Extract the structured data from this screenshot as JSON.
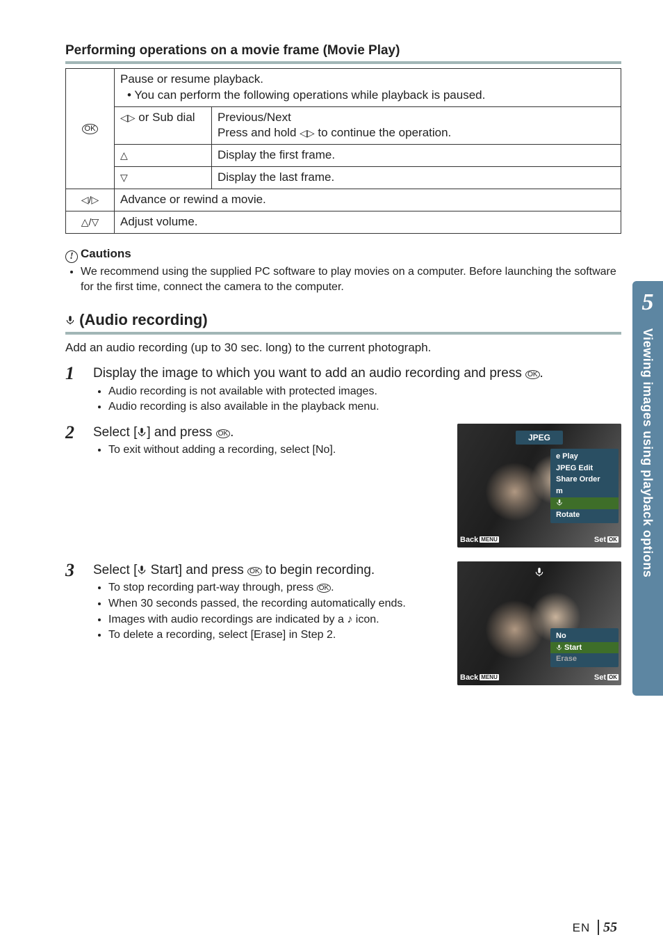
{
  "section1": {
    "title": "Performing operations on a movie frame (Movie Play)"
  },
  "table": {
    "ok_top1": "Pause or resume playback.",
    "ok_top2": "You can perform the following operations while playback is paused.",
    "subdial_label": "or Sub dial",
    "subdial_desc_l1": "Previous/Next",
    "subdial_desc_l2_a": "Press and hold ",
    "subdial_desc_l2_b": " to continue the operation.",
    "up_desc": "Display the first frame.",
    "down_desc": "Display the last frame.",
    "lr_desc": "Advance or rewind a movie.",
    "ud_desc": "Adjust volume."
  },
  "cautions": {
    "heading": "Cautions",
    "item1": "We recommend using the supplied PC software to play movies on a computer. Before launching the software for the first time, connect the camera to the computer."
  },
  "audio": {
    "heading": " (Audio recording)",
    "intro": "Add an audio recording (up to 30 sec. long) to the current photograph."
  },
  "steps": [
    {
      "num": "1",
      "body_a": "Display the image to which you want to add an audio recording and press ",
      "body_b": ".",
      "subs": [
        "Audio recording is not available with protected images.",
        "Audio recording is also available in the playback menu."
      ]
    },
    {
      "num": "2",
      "body_a": "Select [",
      "body_b": "] and press ",
      "body_c": ".",
      "subs": [
        "To exit without adding a recording, select [No]."
      ]
    },
    {
      "num": "3",
      "body_a": "Select [",
      "body_b": " Start] and press ",
      "body_c": " to begin recording.",
      "subs": [
        "To stop recording part-way through, press Q.",
        "When 30 seconds passed, the recording automatically ends.",
        "Images with audio recordings are indicated by a H icon.",
        "To delete a recording, select [Erase] in Step 2."
      ]
    }
  ],
  "screen1": {
    "title": "JPEG",
    "menu": [
      "e Play",
      "JPEG Edit",
      "Share Order",
      "m",
      "R",
      "Rotate"
    ],
    "hl_index": 4,
    "back": "Back",
    "back_tag": "MENU",
    "set": "Set",
    "set_tag": "OK"
  },
  "screen2": {
    "title_icon": "mic",
    "menu": [
      "No",
      "R Start",
      "Erase"
    ],
    "hl_index": 1,
    "dim_index": 2,
    "back": "Back",
    "back_tag": "MENU",
    "set": "Set",
    "set_tag": "OK"
  },
  "sidetab": {
    "num": "5",
    "text": "Viewing images using playback options"
  },
  "footer": {
    "lang": "EN",
    "page": "55"
  }
}
